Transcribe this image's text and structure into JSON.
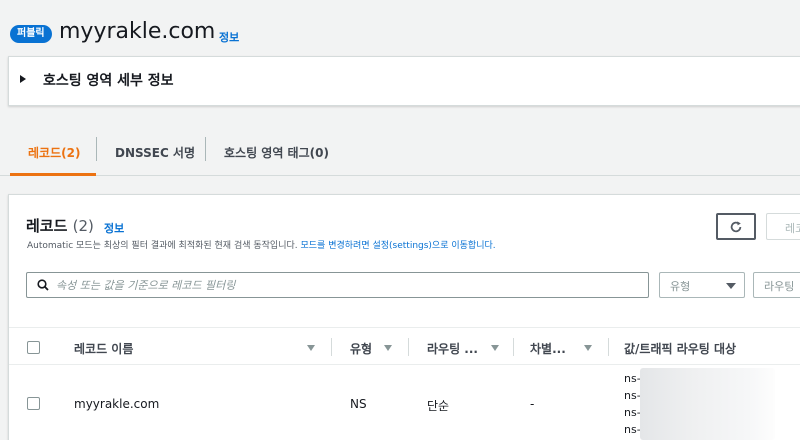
{
  "header": {
    "badge": "퍼블릭",
    "title": "myyrakle.com",
    "info": "정보"
  },
  "details": {
    "label": "호스팅 영역 세부 정보"
  },
  "tabs": [
    {
      "label": "레코드(2)",
      "active": true
    },
    {
      "label": "DNSSEC 서명",
      "active": false
    },
    {
      "label": "호스팅 영역 태그(0)",
      "active": false
    }
  ],
  "records": {
    "heading": "레코드",
    "count": "(2)",
    "info": "정보",
    "description_prefix": "Automatic 모드는 최상의 필터 결과에 최적화된 현재 검색 동작입니다.",
    "description_link": "모드를 변경하려면 설정(settings)으로 이동합니다.",
    "refresh_icon": "refresh-icon",
    "secondary_button": "레코",
    "search_placeholder": "속성 또는 값을 기준으로 레코드 필터링",
    "type_filter": "유형",
    "routing_filter": "라우팅"
  },
  "table": {
    "columns": [
      "레코드 이름",
      "유형",
      "라우팅 ...",
      "차별...",
      "값/트래픽 라우팅 대상"
    ],
    "rows": [
      {
        "name": "myyrakle.com",
        "type": "NS",
        "routing": "단순",
        "differentiator": "-",
        "values": [
          "ns-",
          "ns-",
          "ns-",
          "ns-"
        ]
      }
    ]
  },
  "colors": {
    "accent": "#ec7211",
    "link": "#0972d3",
    "badge": "#0972d3"
  }
}
